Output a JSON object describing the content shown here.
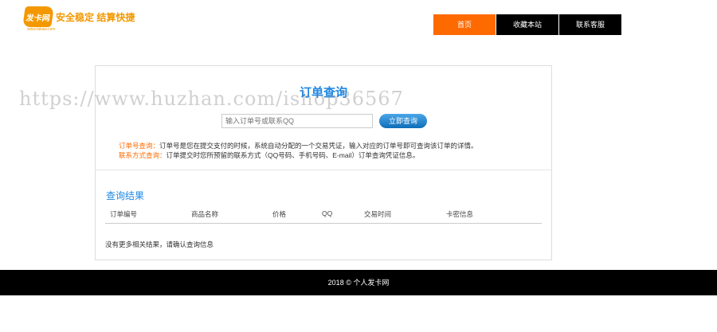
{
  "header": {
    "logo_text": "发卡网",
    "logo_url": "www.fakaw.com",
    "slogan": "安全稳定 结算快捷"
  },
  "nav": [
    {
      "label": "首页"
    },
    {
      "label": "收藏本站"
    },
    {
      "label": "联系客服"
    }
  ],
  "main": {
    "title": "订单查询",
    "search_placeholder": "输入订单号或联系QQ",
    "search_button": "立即查询",
    "tips": [
      {
        "key": "订单号查询：",
        "text": "订单号是您在提交支付的时候，系统自动分配的一个交易凭证，输入对应的订单号即可查询该订单的详情。"
      },
      {
        "key": "联系方式查询：",
        "text": "订单提交时您所预留的联系方式（QQ号码、手机号码、E-mail）订单查询凭证信息。"
      }
    ]
  },
  "results": {
    "title": "查询结果",
    "columns": [
      "订单编号",
      "商品名称",
      "价格",
      "QQ",
      "交易时间",
      "卡密信息"
    ],
    "empty": "没有更多相关结果，请确认查询信息"
  },
  "footer": {
    "text": "2018 © 个人发卡网"
  },
  "watermark": "https://www.huzhan.com/ishop36567"
}
